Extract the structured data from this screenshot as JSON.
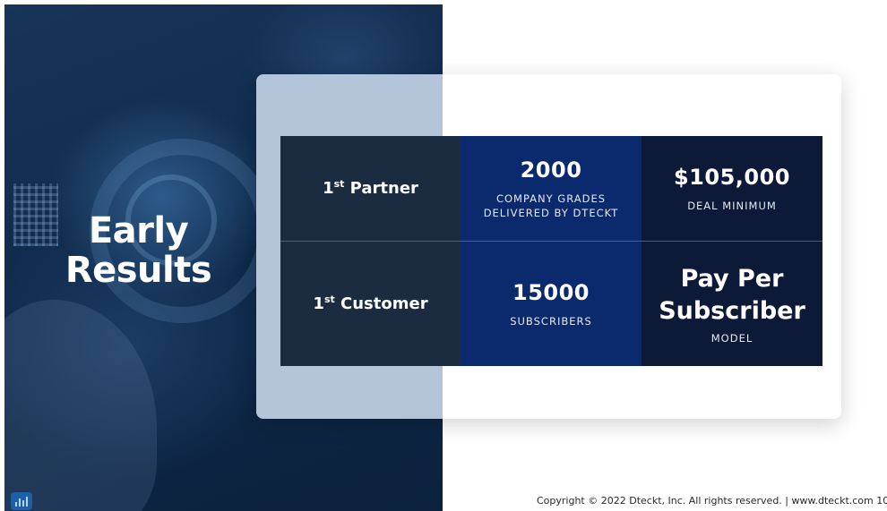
{
  "slide": {
    "title_line1": "Early",
    "title_line2": "Results"
  },
  "table": {
    "row1": {
      "label_ord": "1",
      "label_sup": "st",
      "label_text": " Partner",
      "metric_value": "2000",
      "metric_caption_line1": "COMPANY GRADES",
      "metric_caption_line2": "DELIVERED BY DTECKT",
      "price_value": "$105,000",
      "price_caption": "DEAL MINIMUM"
    },
    "row2": {
      "label_ord": "1",
      "label_sup": "st",
      "label_text": " Customer",
      "metric_value": "15000",
      "metric_caption": "SUBSCRIBERS",
      "model_line1": "Pay Per",
      "model_line2": "Subscriber",
      "model_caption": "MODEL"
    }
  },
  "footer": {
    "copyright": "Copyright © 2022  Dteckt, Inc. All rights reserved. |  www.dteckt.com  10"
  },
  "icons": {
    "corner": "bar-chart-icon"
  },
  "colors": {
    "left_panel": "#0f2a4b",
    "cell_dark": "#1b2b40",
    "cell_blue": "#0b2a6e",
    "cell_navy": "#0c1a38"
  }
}
